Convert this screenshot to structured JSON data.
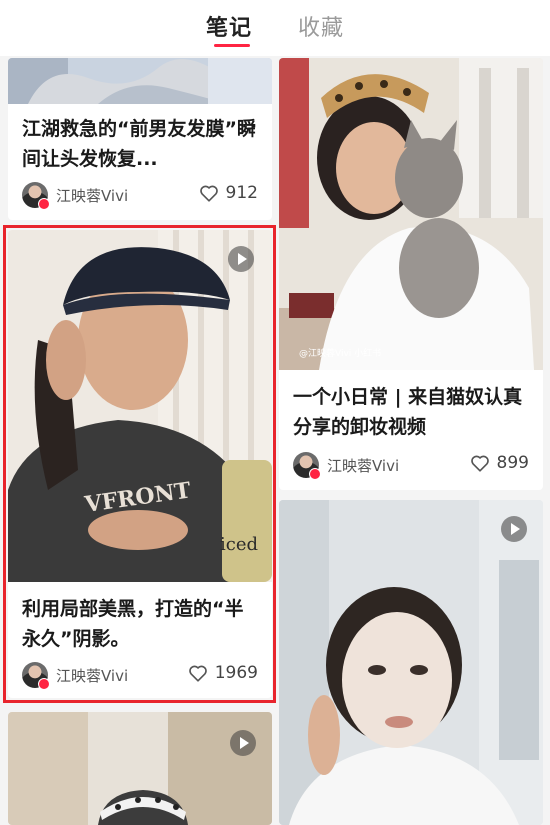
{
  "tabs": {
    "notes": "笔记",
    "favorites": "收藏"
  },
  "colors": {
    "accent": "#ff2442",
    "highlight_border": "#e8242c"
  },
  "cards": [
    {
      "title": "江湖救急的“前男友发膜”瞬间让头发恢复...",
      "author": "江映蓉Vivi",
      "likes": "912"
    },
    {
      "title": "一个小日常 | 来自猫奴认真分享的卸妆视频",
      "author": "江映蓉Vivi",
      "likes": "899",
      "watermark": "@江映蓉Vivi 小红书"
    },
    {
      "title": "利用局部美黑，打造的“半永久”阴影。",
      "author": "江映蓉Vivi",
      "likes": "1969",
      "shirt_text": "ICED"
    },
    {
      "title": "",
      "author": "",
      "likes": ""
    },
    {
      "title": "",
      "author": "",
      "likes": ""
    }
  ],
  "icons": [
    "heart-icon",
    "play-icon",
    "avatar"
  ]
}
